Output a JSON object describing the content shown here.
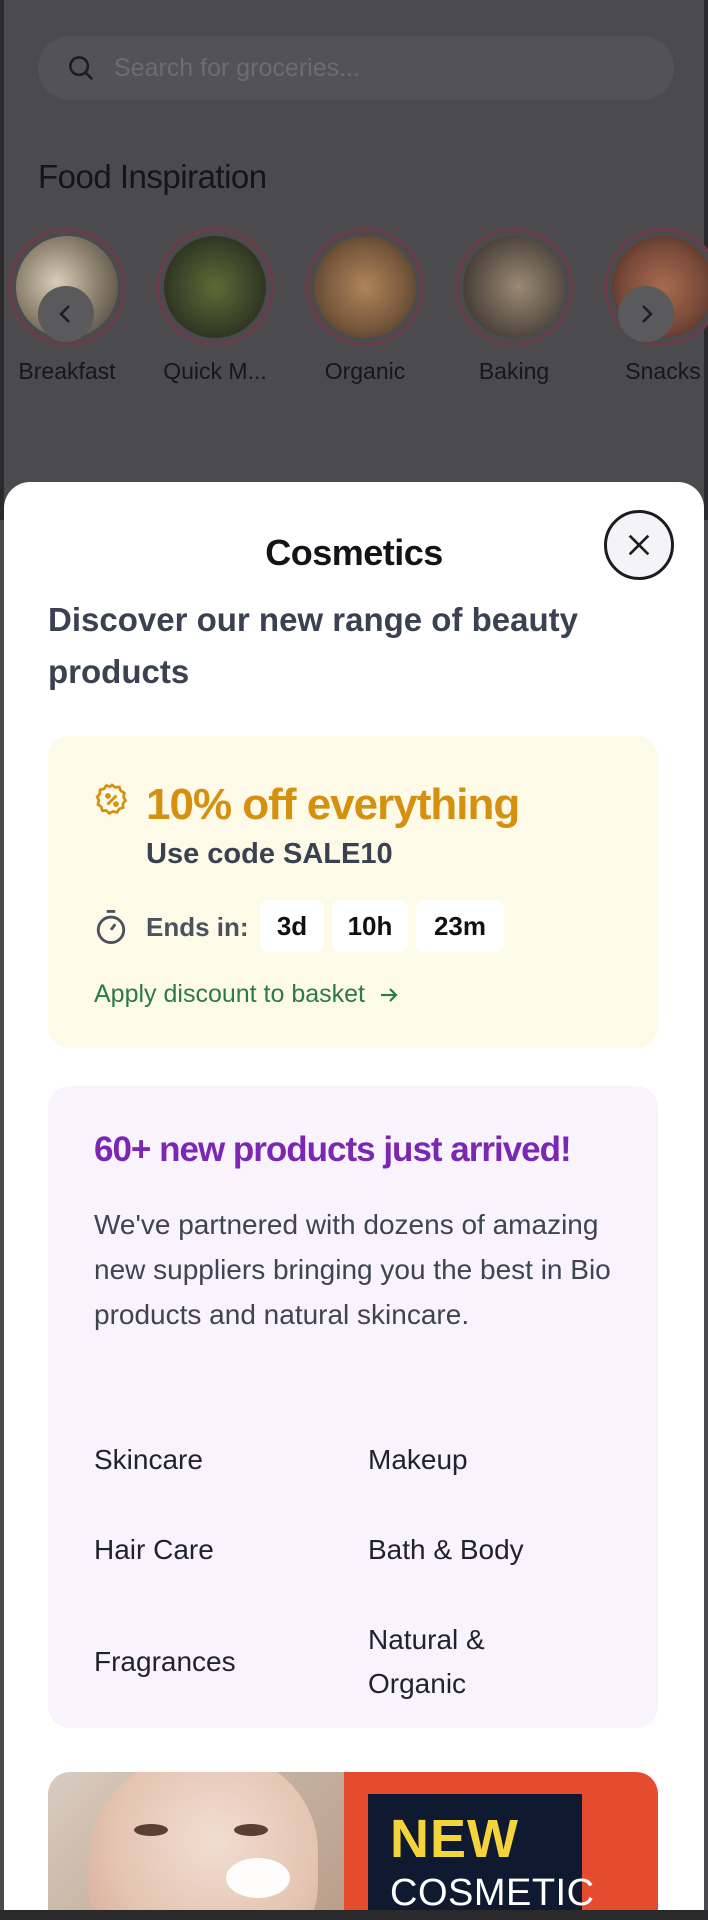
{
  "background": {
    "search": {
      "placeholder": "Search for groceries..."
    },
    "section_title": "Food Inspiration",
    "categories": [
      {
        "label": "Breakfast",
        "color": "#8a7f6c"
      },
      {
        "label": "Quick M...",
        "color": "#3b4128"
      },
      {
        "label": "Organic",
        "color": "#7a5a3e"
      },
      {
        "label": "Baking",
        "color": "#5c5248"
      },
      {
        "label": "Snacks",
        "color": "#7a4a3a"
      }
    ]
  },
  "sheet": {
    "title": "Cosmetics",
    "subtitle": "Discover our new range of beauty products",
    "promo": {
      "headline": "10% off everything",
      "code_text": "Use code SALE10",
      "ends_label": "Ends in:",
      "countdown": [
        "3d",
        "10h",
        "23m"
      ],
      "apply_label": "Apply discount to basket",
      "accent": "#d5900f"
    },
    "info": {
      "headline": "60+ new products just arrived!",
      "paragraph": "We've partnered with dozens of amazing new suppliers bringing you the best in Bio products and natural skincare.",
      "categories": [
        "Skincare",
        "Makeup",
        "Hair Care",
        "Bath & Body",
        "Fragrances",
        "Natural & Organic"
      ],
      "accent": "#7a27b3"
    },
    "banner": {
      "line1": "NEW",
      "line2": "COSMETIC"
    }
  },
  "icons": {
    "search": "search-icon",
    "prev": "chevron-left-icon",
    "next": "chevron-right-icon",
    "close": "close-icon",
    "discount": "discount-badge-icon",
    "timer": "timer-icon",
    "arrow": "arrow-right-icon"
  }
}
